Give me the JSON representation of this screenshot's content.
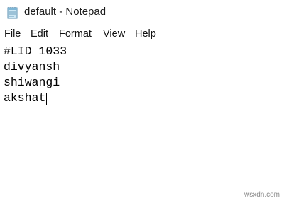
{
  "window": {
    "title": "default - Notepad"
  },
  "menu": {
    "items": [
      "File",
      "Edit",
      "Format",
      "View",
      "Help"
    ]
  },
  "editor": {
    "lines": [
      "#LID 1033",
      "divyansh",
      "shiwangi",
      "akshat"
    ]
  },
  "watermark": "wsxdn.com",
  "icons": {
    "app": "notepad-icon"
  }
}
